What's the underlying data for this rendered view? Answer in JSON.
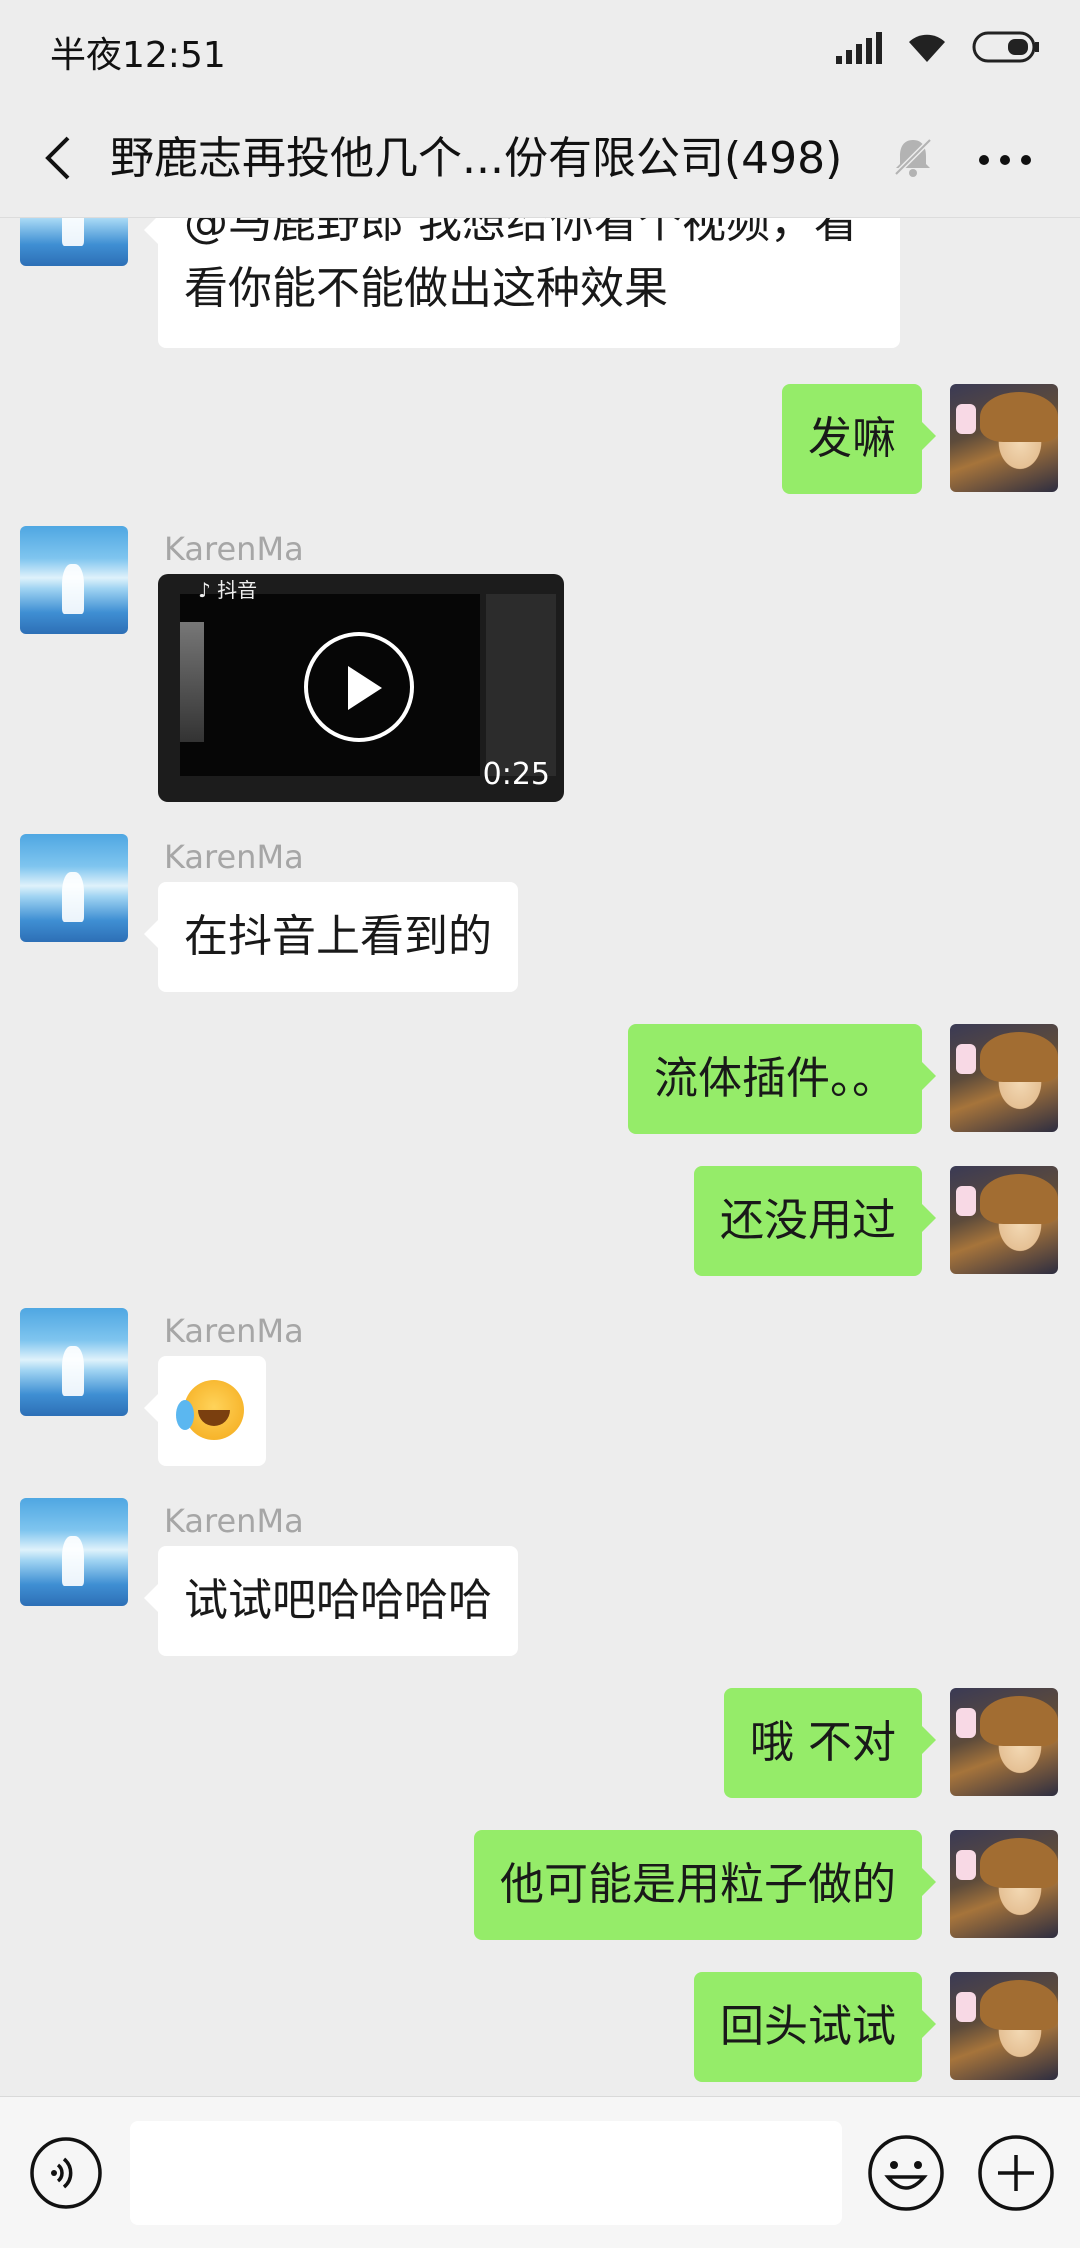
{
  "status_bar": {
    "time": "半夜12:51",
    "icons": [
      "signal-icon",
      "wifi-icon",
      "battery-icon"
    ]
  },
  "header": {
    "title": "野鹿志再投他几个...份有限公司(498)",
    "icons": [
      "back-icon",
      "mute-bell-icon",
      "more-icon"
    ]
  },
  "messages": [
    {
      "side": "left",
      "sender": "",
      "text": "@马鹿野郎 我想给你看个视频，看",
      "text2": "看你能不能做出这种效果"
    },
    {
      "side": "right",
      "text": "发嘛"
    },
    {
      "side": "left",
      "sender": "KarenMa",
      "type": "video",
      "logo": "♪ 抖音",
      "duration": "0:25"
    },
    {
      "side": "left",
      "sender": "KarenMa",
      "text": "在抖音上看到的"
    },
    {
      "side": "right",
      "text": "流体插件。。"
    },
    {
      "side": "right",
      "text": "还没用过"
    },
    {
      "side": "left",
      "sender": "KarenMa",
      "type": "emoji",
      "emoji": "facepalm-laugh-emoji"
    },
    {
      "side": "left",
      "sender": "KarenMa",
      "text": "试试吧哈哈哈哈"
    },
    {
      "side": "right",
      "text": "哦 不对"
    },
    {
      "side": "right",
      "text": "他可能是用粒子做的"
    },
    {
      "side": "right",
      "text": "回头试试"
    }
  ],
  "input_bar": {
    "text_value": "",
    "icons": [
      "voice-icon",
      "emoji-icon",
      "plus-icon"
    ]
  },
  "colors": {
    "background": "#ededed",
    "bubble_self": "#95ec69",
    "bubble_other": "#ffffff",
    "sender_name": "#a6a6a6"
  }
}
